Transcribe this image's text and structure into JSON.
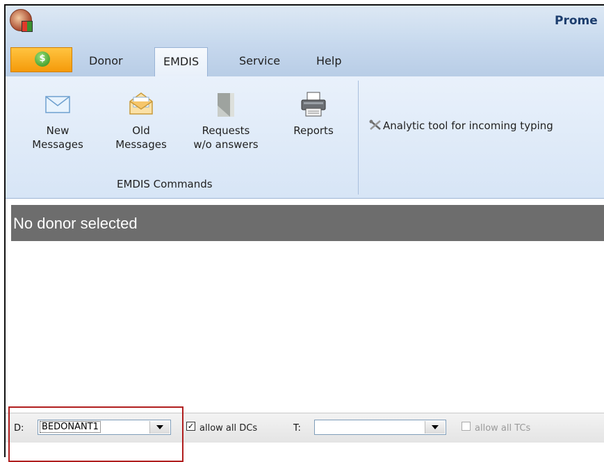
{
  "window": {
    "title": "Prome",
    "app_icon": "app-logo-icon"
  },
  "app_button": {
    "icon": "dollar-orb-icon",
    "glyph": "$"
  },
  "tabs": [
    {
      "label": "Donor",
      "active": false
    },
    {
      "label": "EMDIS",
      "active": true
    },
    {
      "label": "Service",
      "active": false
    },
    {
      "label": "Help",
      "active": false
    }
  ],
  "ribbon": {
    "buttons": [
      {
        "line1": "New",
        "line2": "Messages",
        "icon": "envelope-icon"
      },
      {
        "line1": "Old",
        "line2": "Messages",
        "icon": "open-envelope-icon"
      },
      {
        "line1": "Requests",
        "line2": "w/o answers",
        "icon": "grey-envelope-icon"
      },
      {
        "line1": "Reports",
        "line2": "",
        "icon": "printer-icon"
      }
    ],
    "group_label": "EMDIS Commands",
    "analytic_tool": {
      "label": "Analytic tool for incoming typing",
      "icon": "tools-icon"
    }
  },
  "donor_status": "No donor selected",
  "filter": {
    "d_label": "D:",
    "d_value": "BEDONANT1",
    "allow_dcs": {
      "label": "allow all DCs",
      "checked": true
    },
    "t_label": "T:",
    "t_value": "",
    "allow_tcs": {
      "label": "allow all TCs",
      "checked": false,
      "enabled": false
    }
  },
  "colors": {
    "highlight": "#b01e1e",
    "donor_bar": "#6d6d6d",
    "app_button": "#f59a0a"
  }
}
